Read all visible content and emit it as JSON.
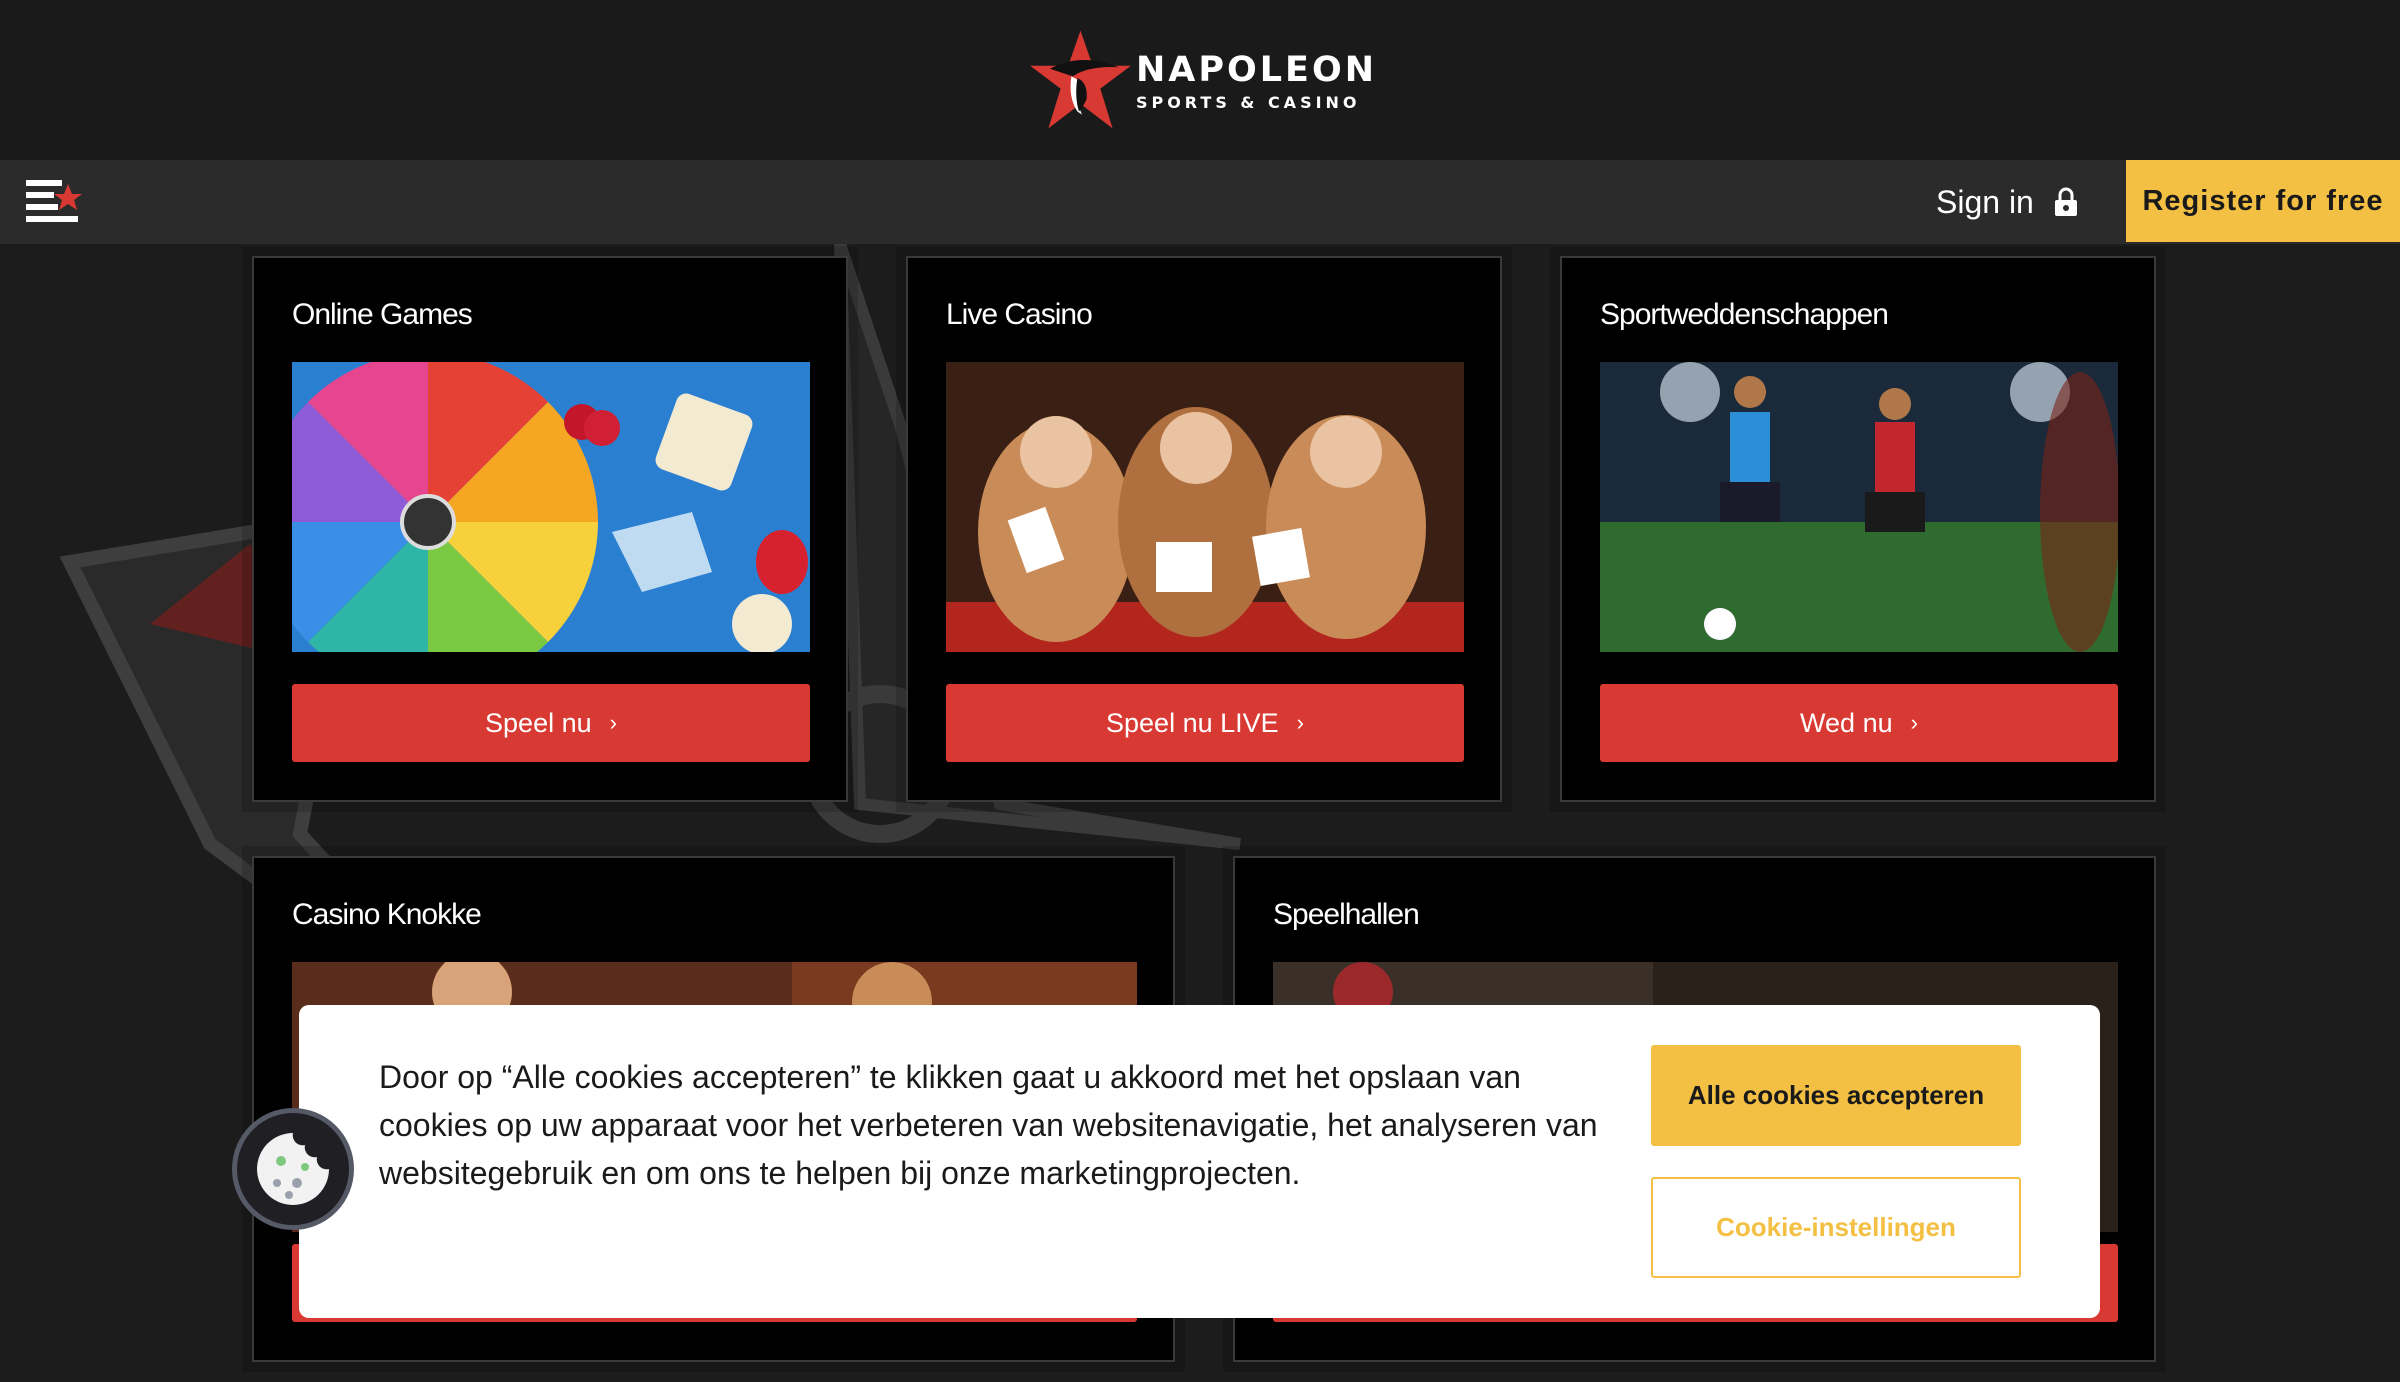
{
  "brand": {
    "name": "NAPOLEON",
    "subtitle": "SPORTS & CASINO",
    "star_color": "#d83a33"
  },
  "nav": {
    "menu_icon": "hamburger-star-icon",
    "signin_label": "Sign in",
    "lock_icon": "lock-icon",
    "register_label": "Register for free",
    "register_color": "#f3c043"
  },
  "cards": [
    {
      "title": "Online Games",
      "button": "Speel nu",
      "image": "wheel-of-fortune-slots"
    },
    {
      "title": "Live Casino",
      "button": "Speel nu LIVE",
      "image": "three-women-holding-cards"
    },
    {
      "title": "Sportweddenschappen",
      "button": "Wed nu",
      "image": "football-players"
    },
    {
      "title": "Casino Knokke",
      "button": "",
      "image": "casino-table-players"
    },
    {
      "title": "Speelhallen",
      "button": "",
      "image": "gaming-hall"
    }
  ],
  "cookie": {
    "text": "Door op “Alle cookies accepteren” te klikken gaat u akkoord met het opslaan van cookies op uw apparaat voor het verbeteren van websitenavigatie, het analyseren van websitegebruik en om ons te helpen bij onze marketingprojecten.",
    "accept_label": "Alle cookies accepteren",
    "settings_label": "Cookie-instellingen",
    "fab_icon": "cookie-icon"
  },
  "colors": {
    "button_red": "#d83a33",
    "accent_yellow": "#f3c043",
    "card_bg": "#000000",
    "page_bg": "#1c1c1c"
  }
}
